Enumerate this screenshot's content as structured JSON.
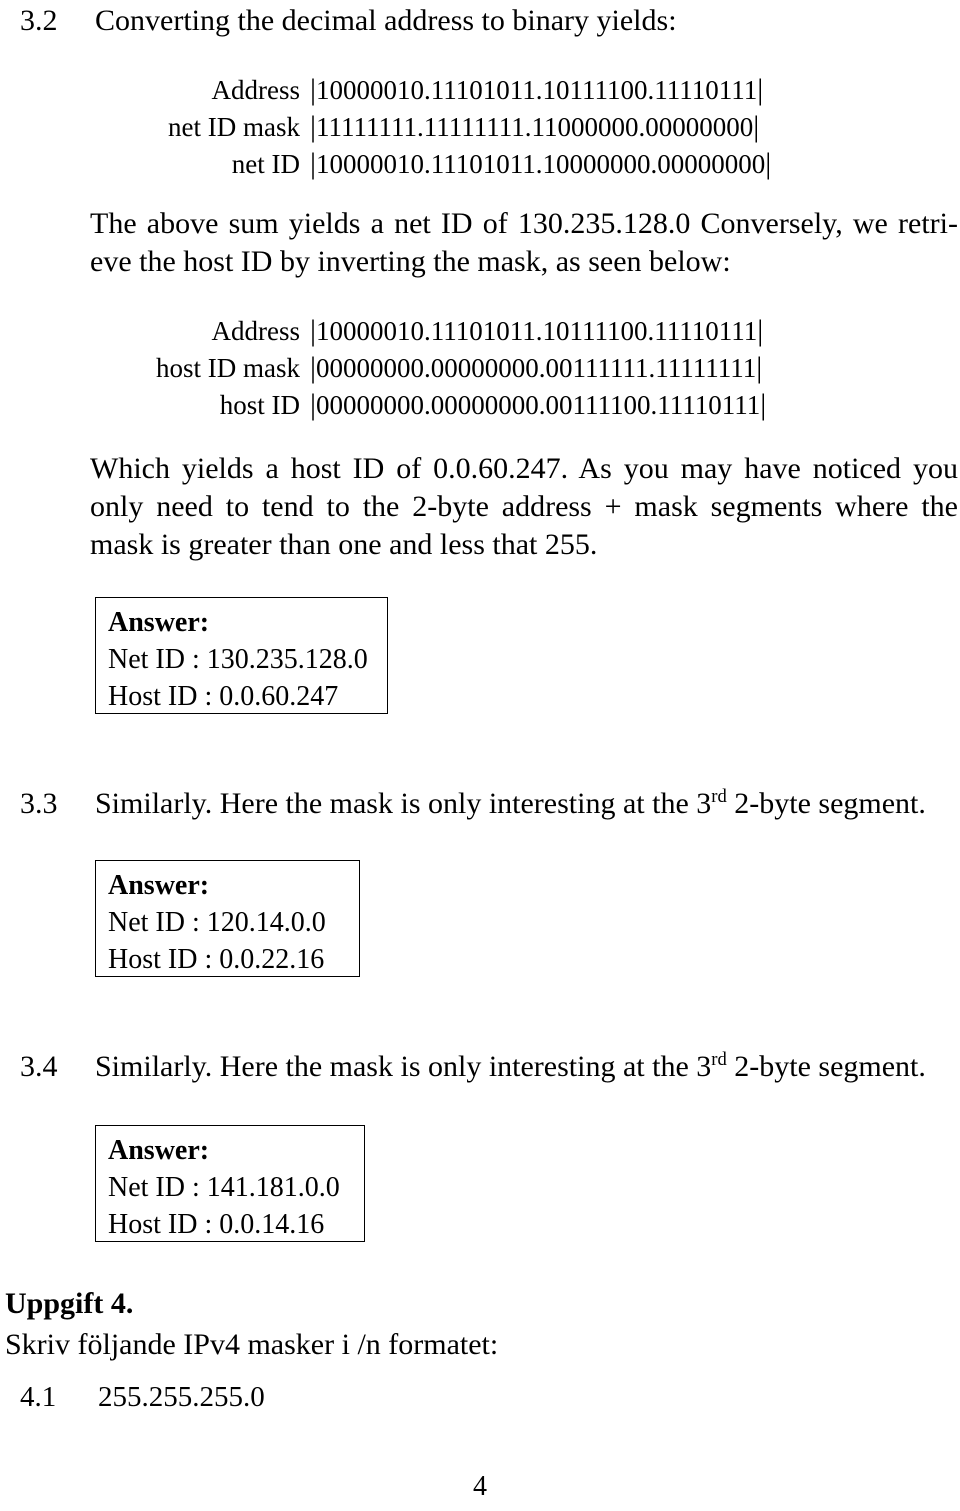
{
  "document": {
    "page_number": "4"
  },
  "section_3_2": {
    "number": "3.2",
    "title": "Converting the decimal address to binary yields:",
    "table1": {
      "rows": [
        {
          "label": "Address",
          "value": "10000010.11101011.10111100.11110111"
        },
        {
          "label": "net ID mask",
          "value": "11111111.11111111.11000000.00000000"
        },
        {
          "label": "net ID",
          "value": "10000010.11101011.10000000.00000000"
        }
      ]
    },
    "paragraph1": {
      "line1": "The above sum yields a net ID of 130.235.128.0 Conversely, we retri-",
      "line2": "eve the host ID by inverting the mask, as seen below:"
    },
    "table2": {
      "rows": [
        {
          "label": "Address",
          "value": "10000010.11101011.10111100.11110111"
        },
        {
          "label": "host ID mask",
          "value": "00000000.00000000.00111111.11111111"
        },
        {
          "label": "host ID",
          "value": "00000000.00000000.00111100.11110111"
        }
      ]
    },
    "paragraph2": {
      "line1": "Which yields a host ID of 0.0.60.247. As you may have noticed you",
      "line2": "only need to tend to the 2-byte address + mask segments where the",
      "line3": "mask is greater than one and less that 255."
    },
    "answer": {
      "title": "Answer:",
      "net_id": "Net ID : 130.235.128.0",
      "host_id": "Host ID : 0.0.60.247"
    }
  },
  "section_3_3": {
    "number": "3.3",
    "title_before": "Similarly. Here the mask is only interesting at the 3",
    "title_ordinal": "rd",
    "title_after": " 2-byte segment.",
    "answer": {
      "title": "Answer:",
      "net_id": "Net ID : 120.14.0.0",
      "host_id": "Host ID : 0.0.22.16"
    }
  },
  "section_3_4": {
    "number": "3.4",
    "title_before": "Similarly. Here the mask is only interesting at the 3",
    "title_ordinal": "rd",
    "title_after": " 2-byte segment.",
    "answer": {
      "title": "Answer:",
      "net_id": "Net ID : 141.181.0.0",
      "host_id": "Host ID : 0.0.14.16"
    }
  },
  "uppgift_4": {
    "heading": "Uppgift 4.",
    "instruction": "Skriv följande IPv4 masker i /n formatet:",
    "items": [
      {
        "number": "4.1",
        "value": "255.255.255.0"
      }
    ]
  }
}
